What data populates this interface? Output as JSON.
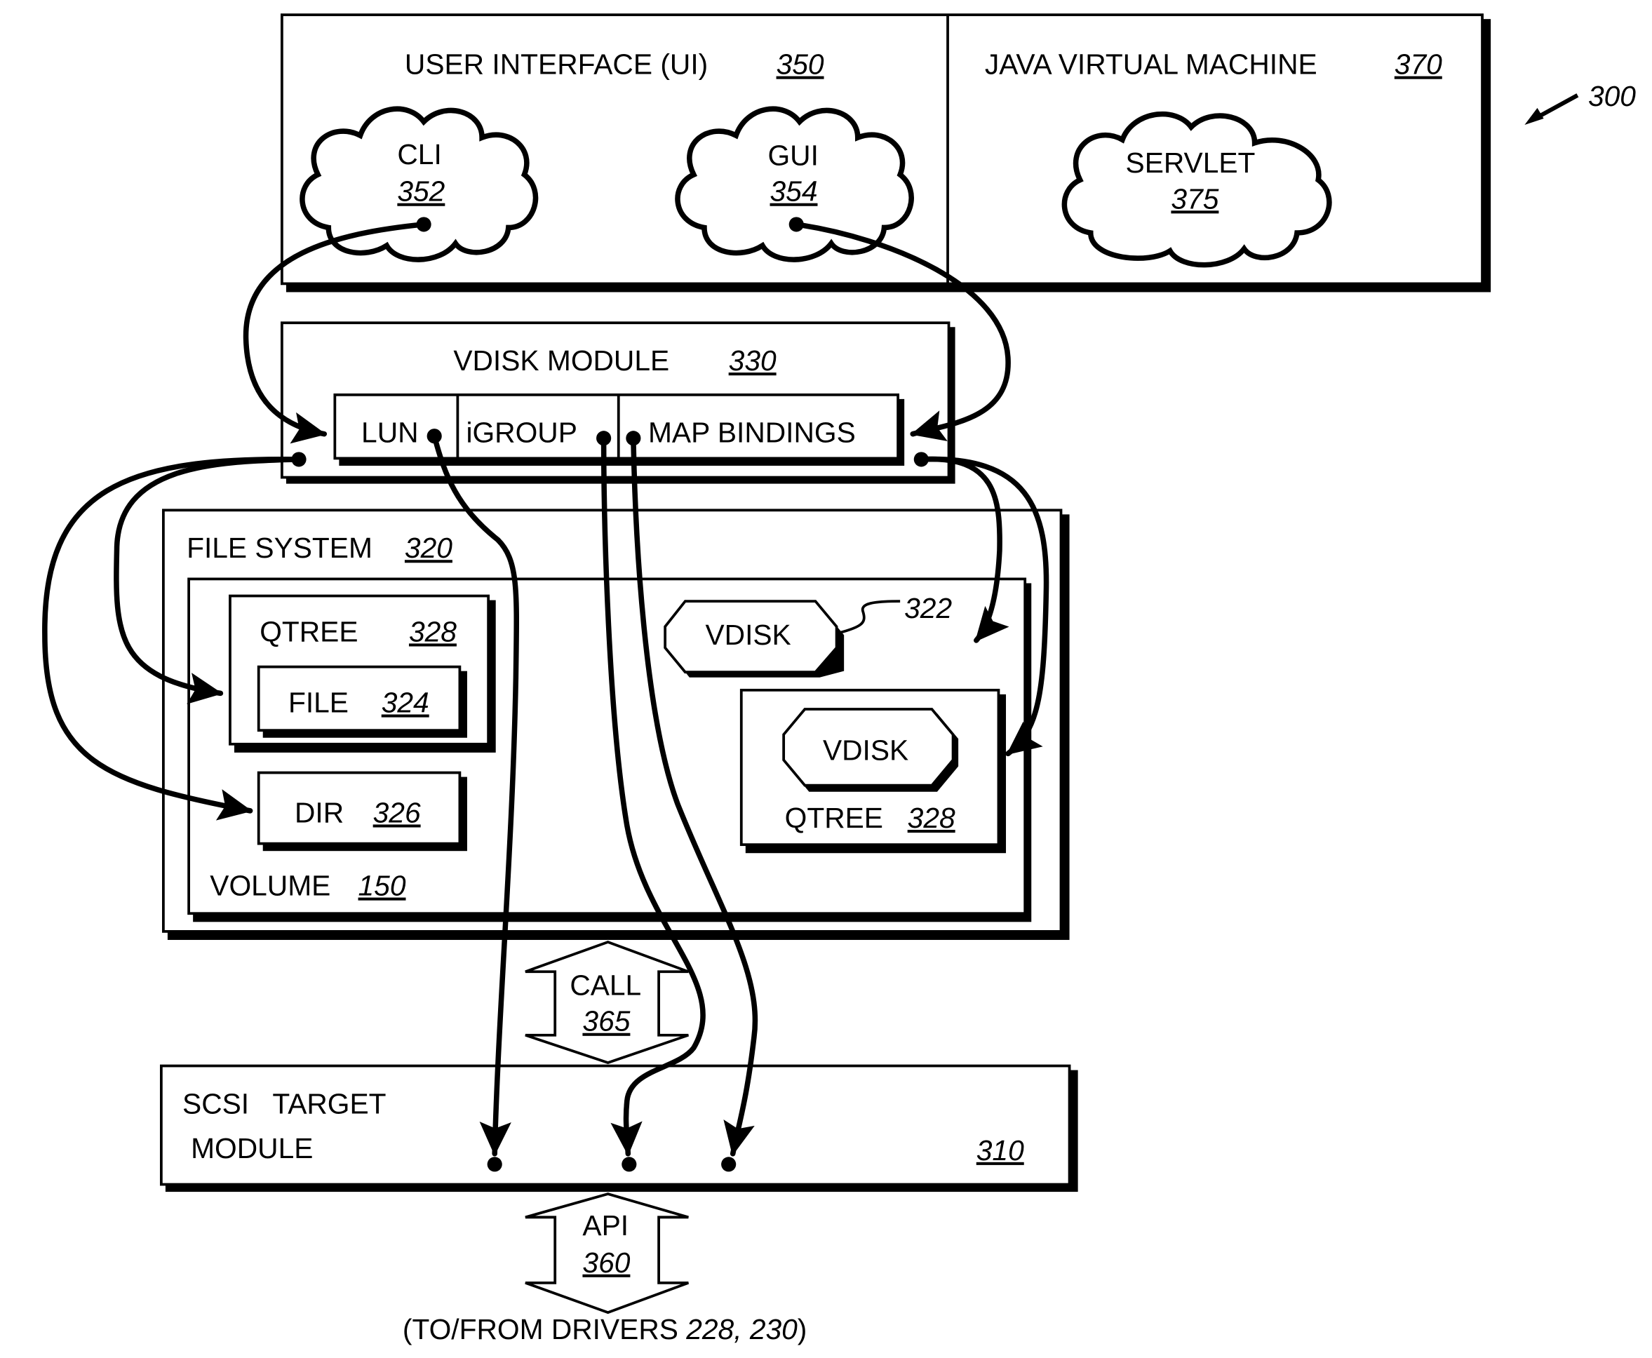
{
  "figure_ref": "300",
  "ui": {
    "title": "USER INTERFACE (UI)",
    "ref": "350",
    "cli": {
      "label": "CLI",
      "ref": "352"
    },
    "gui": {
      "label": "GUI",
      "ref": "354"
    }
  },
  "jvm": {
    "title": "JAVA VIRTUAL MACHINE",
    "ref": "370",
    "servlet": {
      "label": "SERVLET",
      "ref": "375"
    }
  },
  "vdisk_module": {
    "title": "VDISK MODULE",
    "ref": "330",
    "cells": [
      "LUN",
      "iGROUP",
      "MAP BINDINGS"
    ]
  },
  "file_system": {
    "title": "FILE SYSTEM",
    "ref": "320",
    "volume": {
      "label": "VOLUME",
      "ref": "150"
    },
    "qtree_left": {
      "label": "QTREE",
      "ref": "328"
    },
    "file": {
      "label": "FILE",
      "ref": "324"
    },
    "dir": {
      "label": "DIR",
      "ref": "326"
    },
    "vdisk_free": {
      "label": "VDISK",
      "ref": "322"
    },
    "qtree_right": {
      "label": "QTREE",
      "ref": "328",
      "vdisk_label": "VDISK"
    }
  },
  "call": {
    "label": "CALL",
    "ref": "365"
  },
  "scsi": {
    "line1": "SCSI   TARGET",
    "line2": "MODULE",
    "ref": "310"
  },
  "api": {
    "label": "API",
    "ref": "360"
  },
  "drivers_note": {
    "prefix": "(TO/FROM DRIVERS ",
    "refs": "228, 230",
    "suffix": ")"
  }
}
